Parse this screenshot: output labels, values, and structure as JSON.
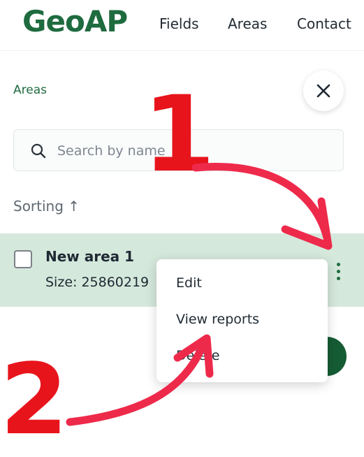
{
  "header": {
    "logo": "GeoAP",
    "nav": [
      "Fields",
      "Areas",
      "Contact"
    ]
  },
  "panel": {
    "breadcrumb": "Areas",
    "search_placeholder": "Search by name",
    "sorting_label": "Sorting ↑"
  },
  "area_row": {
    "name": "New area 1",
    "size": "Size: 25860219"
  },
  "context_menu": {
    "items": [
      "Edit",
      "View reports",
      "Delete"
    ]
  },
  "annotations": {
    "step1": "1",
    "step2": "2",
    "color": "#e8141c"
  },
  "colors": {
    "brand": "#1e6b3f",
    "row_highlight": "#d5e8dc",
    "arrow": "#ee2a4b"
  }
}
